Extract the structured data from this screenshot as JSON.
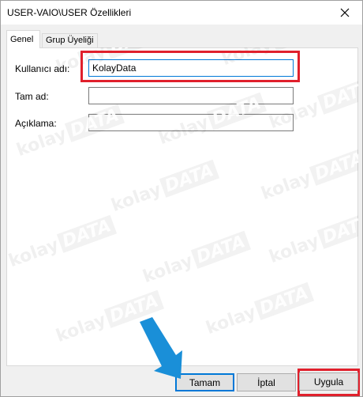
{
  "window": {
    "title": "USER-VAIO\\USER Özellikleri",
    "close_icon": "close-icon"
  },
  "tabs": [
    {
      "label": "Genel",
      "active": true
    },
    {
      "label": "Grup Üyeliği",
      "active": false
    }
  ],
  "form": {
    "username_label": "Kullanıcı adı:",
    "username_value": "KolayData",
    "fullname_label": "Tam ad:",
    "fullname_value": "",
    "description_label": "Açıklama:",
    "description_value": ""
  },
  "watermark": {
    "text": "kolay",
    "box": "DATA"
  },
  "buttons": {
    "ok": "Tamam",
    "cancel": "İptal",
    "apply": "Uygula"
  },
  "colors": {
    "highlight": "#e0202c",
    "arrow": "#1a8fd8",
    "focus": "#0078d7"
  }
}
